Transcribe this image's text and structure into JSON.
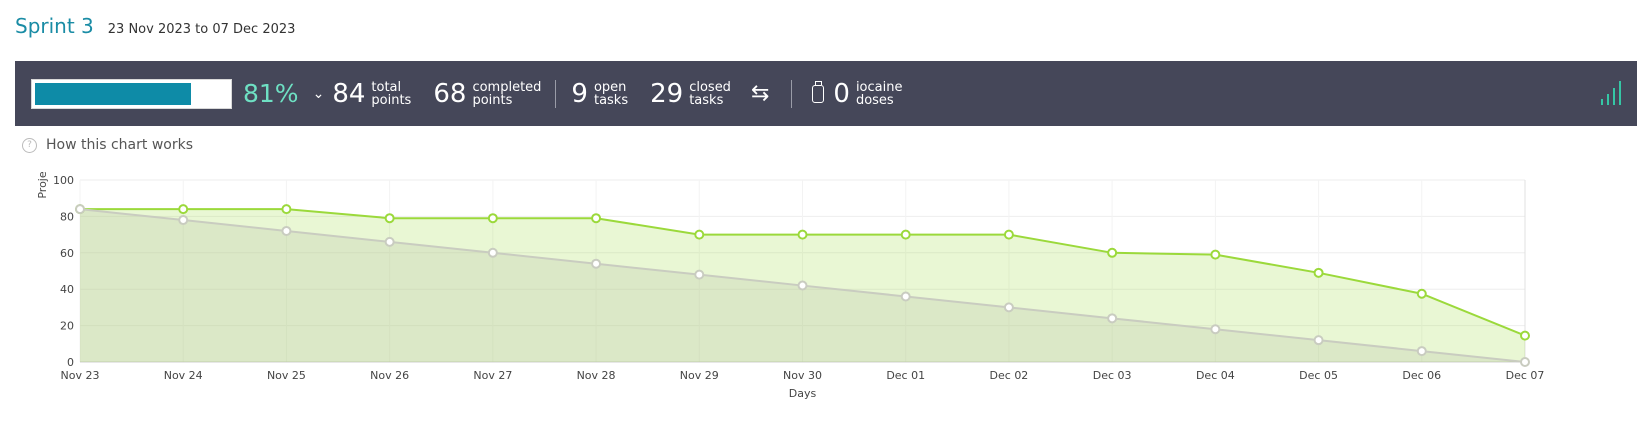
{
  "header": {
    "title": "Sprint 3",
    "dates": "23 Nov 2023 to 07 Dec 2023"
  },
  "summary": {
    "progress_percent": 81,
    "progress_text": "81%",
    "total_points": "84",
    "total_label_1": "total",
    "total_label_2": "points",
    "completed_points": "68",
    "completed_label_1": "completed",
    "completed_label_2": "points",
    "open_tasks": "9",
    "open_label_1": "open",
    "open_label_2": "tasks",
    "closed_tasks": "29",
    "closed_label_1": "closed",
    "closed_label_2": "tasks",
    "iocaine": "0",
    "iocaine_label_1": "iocaine",
    "iocaine_label_2": "doses"
  },
  "help": {
    "text": "How this chart works"
  },
  "colors": {
    "accent": "#1a8ca5",
    "bar_bg": "#454759",
    "progress": "#0e8ba7",
    "percent": "#6ee0c3",
    "real": "#9bd93b",
    "ideal": "#c9ccc0"
  },
  "chart_data": {
    "type": "area",
    "xlabel": "Days",
    "ylabel": "Proje",
    "ylim": [
      0,
      100
    ],
    "yticks": [
      0,
      20,
      40,
      60,
      80,
      100
    ],
    "categories": [
      "Nov 23",
      "Nov 24",
      "Nov 25",
      "Nov 26",
      "Nov 27",
      "Nov 28",
      "Nov 29",
      "Nov 30",
      "Dec 01",
      "Dec 02",
      "Dec 03",
      "Dec 04",
      "Dec 05",
      "Dec 06",
      "Dec 07"
    ],
    "series": [
      {
        "values": [
          84,
          84,
          84,
          79,
          79,
          79,
          70,
          70,
          70,
          70,
          60,
          59,
          49,
          37.5,
          14.5
        ]
      },
      {
        "values": [
          84,
          78,
          72,
          66,
          60,
          54,
          48,
          42,
          36,
          30,
          24,
          18,
          12,
          6,
          0
        ]
      }
    ]
  }
}
